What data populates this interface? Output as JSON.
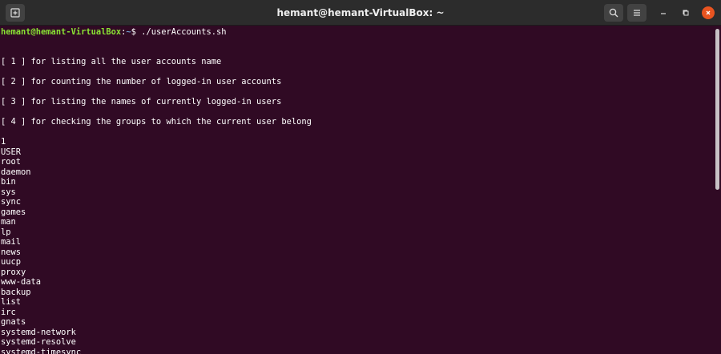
{
  "window": {
    "title": "hemant@hemant-VirtualBox: ~"
  },
  "prompt": {
    "user_host": "hemant@hemant-VirtualBox",
    "sep": ":",
    "path": "~",
    "symbol": "$",
    "command": " ./userAccounts.sh"
  },
  "menu_lines": [
    "[ 1 ] for listing all the user accounts name",
    "[ 2 ] for counting the number of logged-in user accounts",
    "[ 3 ] for listing the names of currently logged-in users",
    "[ 4 ] for checking the groups to which the current user belong"
  ],
  "output_lines": [
    "1",
    "USER",
    "root",
    "daemon",
    "bin",
    "sys",
    "sync",
    "games",
    "man",
    "lp",
    "mail",
    "news",
    "uucp",
    "proxy",
    "www-data",
    "backup",
    "list",
    "irc",
    "gnats",
    "systemd-network",
    "systemd-resolve",
    "systemd-timesync"
  ],
  "icons": {
    "new_tab": "new-tab-icon",
    "search": "search-icon",
    "menu": "hamburger-icon",
    "minimize": "minimize-icon",
    "maximize": "maximize-icon",
    "close": "close-icon"
  },
  "colors": {
    "terminal_bg": "#300a24",
    "titlebar_bg": "#2c2c2c",
    "prompt_user": "#8ae234",
    "prompt_path": "#729fcf",
    "close_button": "#e95420"
  }
}
